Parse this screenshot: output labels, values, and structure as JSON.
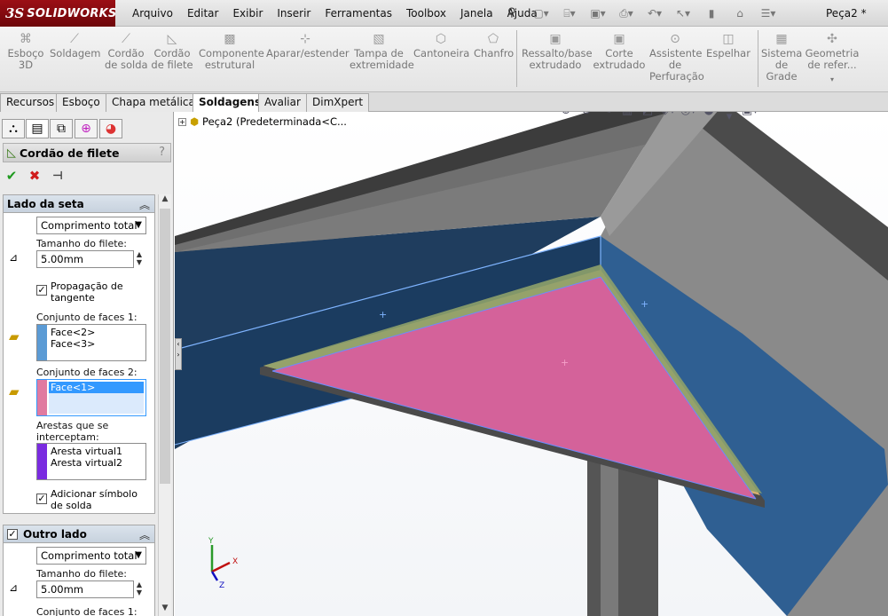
{
  "app": {
    "brand_ds": "3S",
    "brand_name": "SOLIDWORKS",
    "document_title": "Peça2 *"
  },
  "menus": [
    "Arquivo",
    "Editar",
    "Exibir",
    "Inserir",
    "Ferramentas",
    "Toolbox",
    "Janela",
    "Ajuda"
  ],
  "commands": [
    {
      "label": "Esboço\n3D",
      "icon": "3d-sketch-icon"
    },
    {
      "label": "Soldagem",
      "icon": "weldment-icon"
    },
    {
      "label": "Cordão\nde solda",
      "icon": "weld-bead-icon"
    },
    {
      "label": "Cordão\nde filete",
      "icon": "fillet-bead-icon"
    },
    {
      "label": "Componente\nestrutural",
      "icon": "structural-member-icon"
    },
    {
      "label": "Aparar/estender",
      "icon": "trim-extend-icon"
    },
    {
      "label": "Tampa de\nextremidade",
      "icon": "end-cap-icon"
    },
    {
      "label": "Cantoneira",
      "icon": "gusset-icon"
    },
    {
      "label": "Chanfro",
      "icon": "chamfer-icon"
    },
    {
      "label": "Ressalto/base\nextrudado",
      "icon": "extruded-boss-icon"
    },
    {
      "label": "Corte\nextrudado",
      "icon": "extruded-cut-icon"
    },
    {
      "label": "Assistente\nde\nPerfuração",
      "icon": "hole-wizard-icon"
    },
    {
      "label": "Espelhar",
      "icon": "mirror-icon"
    },
    {
      "label": "Sistema\nde\nGrade",
      "icon": "grid-system-icon"
    },
    {
      "label": "Geometria\nde refer...",
      "icon": "reference-geometry-icon"
    }
  ],
  "tabs": [
    {
      "label": "Recursos",
      "active": false
    },
    {
      "label": "Esboço",
      "active": false
    },
    {
      "label": "Chapa metálica",
      "active": false
    },
    {
      "label": "Soldagens",
      "active": true
    },
    {
      "label": "Avaliar",
      "active": false
    },
    {
      "label": "DimXpert",
      "active": false
    }
  ],
  "property_manager": {
    "title": "Cordão de filete",
    "help": "?",
    "group_arrow": {
      "title": "Lado da seta",
      "type_value": "Comprimento total",
      "size_label": "Tamanho do filete:",
      "size_value": "5.00mm",
      "tangent_label_1": "Propagação de",
      "tangent_label_2": "tangente",
      "tangent_checked": true,
      "faces1_label": "Conjunto de faces 1:",
      "faces1_items": [
        "Face<2>",
        "Face<3>"
      ],
      "faces1_color": "#5b9bd5",
      "faces2_label": "Conjunto de faces 2:",
      "faces2_items": [
        "Face<1>"
      ],
      "faces2_color": "#e07aa0",
      "edges_label_1": "Arestas que se",
      "edges_label_2": "interceptam:",
      "edges_items": [
        "Aresta virtual1",
        "Aresta virtual2"
      ],
      "edges_color": "#7a2be0",
      "symbol_label_1": "Adicionar símbolo",
      "symbol_label_2": "de solda",
      "symbol_checked": true
    },
    "group_other": {
      "title": "Outro lado",
      "checked": true,
      "type_value": "Comprimento total",
      "size_label": "Tamanho do filete:",
      "size_value": "5.00mm",
      "faces1_label": "Conjunto de faces 1:"
    }
  },
  "tree": {
    "label": "Peça2  (Predeterminada<C..."
  },
  "triad": {
    "x": "X",
    "y": "Y",
    "z": "Z"
  }
}
